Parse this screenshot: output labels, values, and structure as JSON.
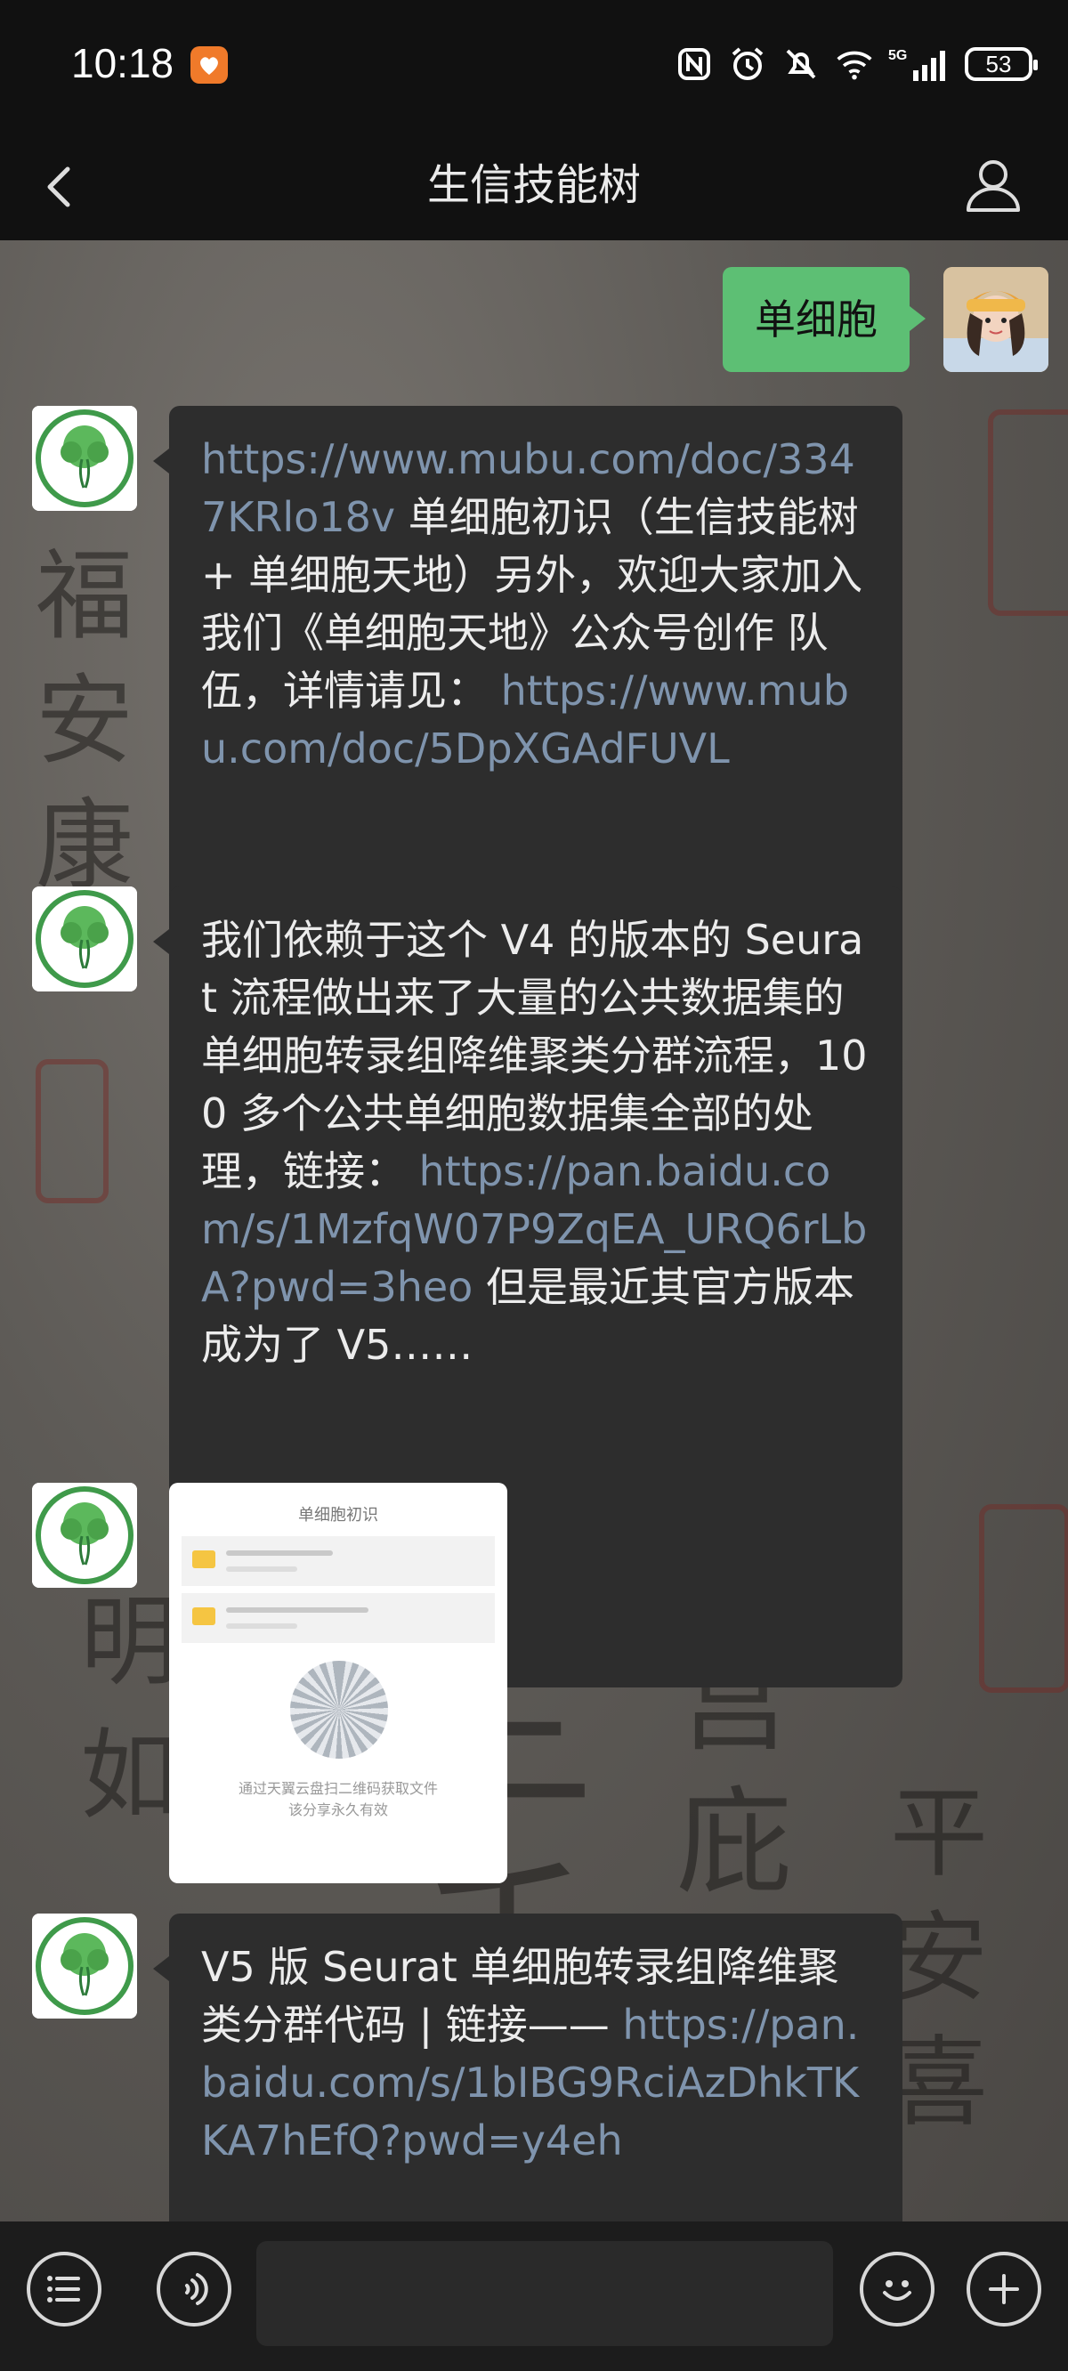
{
  "status_bar": {
    "time": "10:18",
    "battery": "53",
    "network": "5G"
  },
  "header": {
    "title": "生信技能树"
  },
  "messages": {
    "m0": {
      "text": "单细胞"
    },
    "m1": {
      "link1": "https://www.mubu.com/doc/3347KRlo18v",
      "text1": "单细胞初识（生信技能树 + 单细胞天地）另外，欢迎大家加入我们《单细胞天地》公众号创作 队伍，详情请见：",
      "link2": "https://www.mubu.com/doc/5DpXGAdFUVL"
    },
    "m2": {
      "text1": "我们依赖于这个 V4 的版本的 Seurat 流程做出来了大量的公共数据集的单细胞转录组降维聚类分群流程，100 多个公共单细胞数据集全部的处理，链接：",
      "link": "https://pan.baidu.com/s/1MzfqW07P9ZqEA_URQ6rLbA?pwd=3heo",
      "text2": " 但是最近其官方版本成为了 V5……"
    },
    "m3": {
      "image_title": "单细胞初识",
      "image_caption": "通过天翼云盘扫二维码获取文件",
      "image_caption2": "该分享永久有效"
    },
    "m4": {
      "text1": "V5 版 Seurat 单细胞转录组降维聚类分群代码 | 链接——",
      "link": "https://pan.baidu.com/s/1bIBG9RciAzDhkTKKA7hEfQ?pwd=y4eh"
    }
  },
  "colors": {
    "link": "#7f94ad",
    "my_bubble": "#5dbf74",
    "bubble": "#2d2d2d"
  }
}
